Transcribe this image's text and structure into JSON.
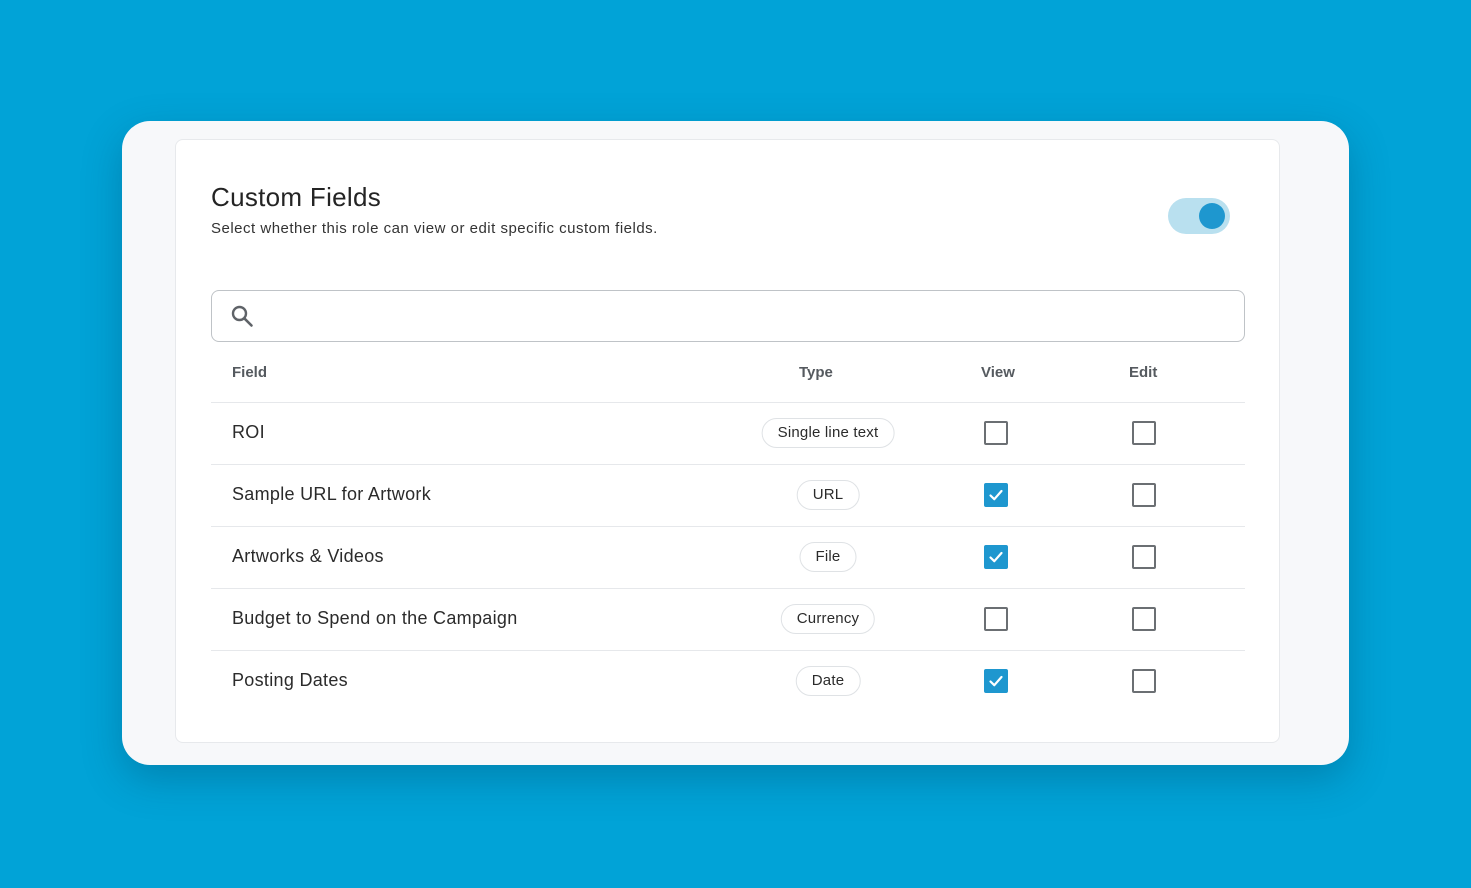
{
  "panel": {
    "title": "Custom Fields",
    "subtitle": "Select whether this role can view or edit specific custom fields.",
    "toggle_on": true
  },
  "search": {
    "value": "",
    "placeholder": ""
  },
  "table": {
    "headers": {
      "field": "Field",
      "type": "Type",
      "view": "View",
      "edit": "Edit"
    },
    "rows": [
      {
        "name": "ROI",
        "type": "Single line text",
        "view": false,
        "edit": false
      },
      {
        "name": "Sample URL for Artwork",
        "type": "URL",
        "view": true,
        "edit": false
      },
      {
        "name": "Artworks & Videos",
        "type": "File",
        "view": true,
        "edit": false
      },
      {
        "name": "Budget to Spend on the Campaign",
        "type": "Currency",
        "view": false,
        "edit": false
      },
      {
        "name": "Posting Dates",
        "type": "Date",
        "view": true,
        "edit": false
      }
    ]
  },
  "colors": {
    "background": "#01a3d7",
    "accent": "#1e97cf",
    "toggle_track": "#b9e0ef"
  }
}
